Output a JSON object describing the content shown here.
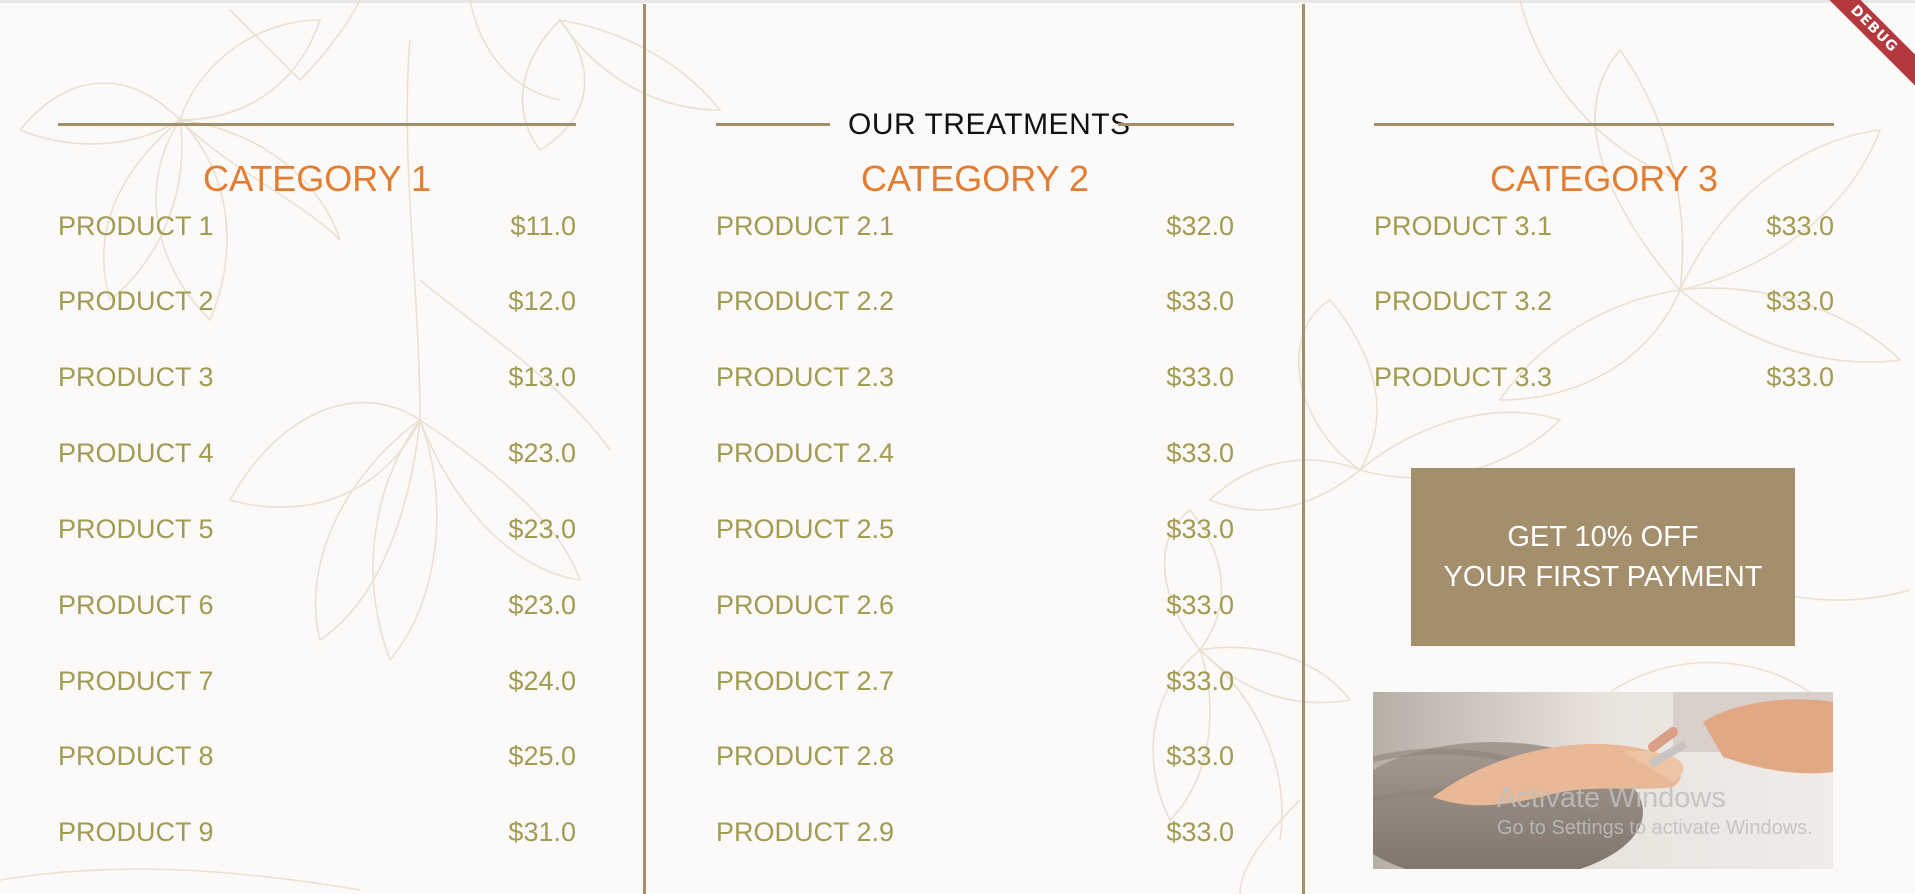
{
  "header": {
    "section_title": "OUR TREATMENTS"
  },
  "colors": {
    "background": "#fcf9f9",
    "divider": "#a38f6c",
    "category_title": "#e27d32",
    "product_text": "#a29b53",
    "promo_bg": "#a38f6c",
    "promo_text": "#ffffff"
  },
  "categories": [
    {
      "title": "CATEGORY 1",
      "products": [
        {
          "name": "PRODUCT 1",
          "price": "$11.0"
        },
        {
          "name": "PRODUCT 2",
          "price": "$12.0"
        },
        {
          "name": "PRODUCT 3",
          "price": "$13.0"
        },
        {
          "name": "PRODUCT 4",
          "price": "$23.0"
        },
        {
          "name": "PRODUCT 5",
          "price": "$23.0"
        },
        {
          "name": "PRODUCT 6",
          "price": "$23.0"
        },
        {
          "name": "PRODUCT 7",
          "price": "$24.0"
        },
        {
          "name": "PRODUCT 8",
          "price": "$25.0"
        },
        {
          "name": "PRODUCT 9",
          "price": "$31.0"
        }
      ]
    },
    {
      "title": "CATEGORY 2",
      "products": [
        {
          "name": "PRODUCT 2.1",
          "price": "$32.0"
        },
        {
          "name": "PRODUCT 2.2",
          "price": "$33.0"
        },
        {
          "name": "PRODUCT 2.3",
          "price": "$33.0"
        },
        {
          "name": "PRODUCT 2.4",
          "price": "$33.0"
        },
        {
          "name": "PRODUCT 2.5",
          "price": "$33.0"
        },
        {
          "name": "PRODUCT 2.6",
          "price": "$33.0"
        },
        {
          "name": "PRODUCT 2.7",
          "price": "$33.0"
        },
        {
          "name": "PRODUCT 2.8",
          "price": "$33.0"
        },
        {
          "name": "PRODUCT 2.9",
          "price": "$33.0"
        }
      ]
    },
    {
      "title": "CATEGORY 3",
      "products": [
        {
          "name": "PRODUCT 3.1",
          "price": "$33.0"
        },
        {
          "name": "PRODUCT 3.2",
          "price": "$33.0"
        },
        {
          "name": "PRODUCT 3.3",
          "price": "$33.0"
        }
      ]
    }
  ],
  "promo": {
    "line1": "GET 10% OFF",
    "line2": "YOUR FIRST PAYMENT"
  },
  "photo": {
    "icon": "manicure-photo"
  },
  "watermark": {
    "line1": "Activate Windows",
    "line2": "Go to Settings to activate Windows."
  },
  "debug_banner": {
    "label": "DEBUG"
  }
}
